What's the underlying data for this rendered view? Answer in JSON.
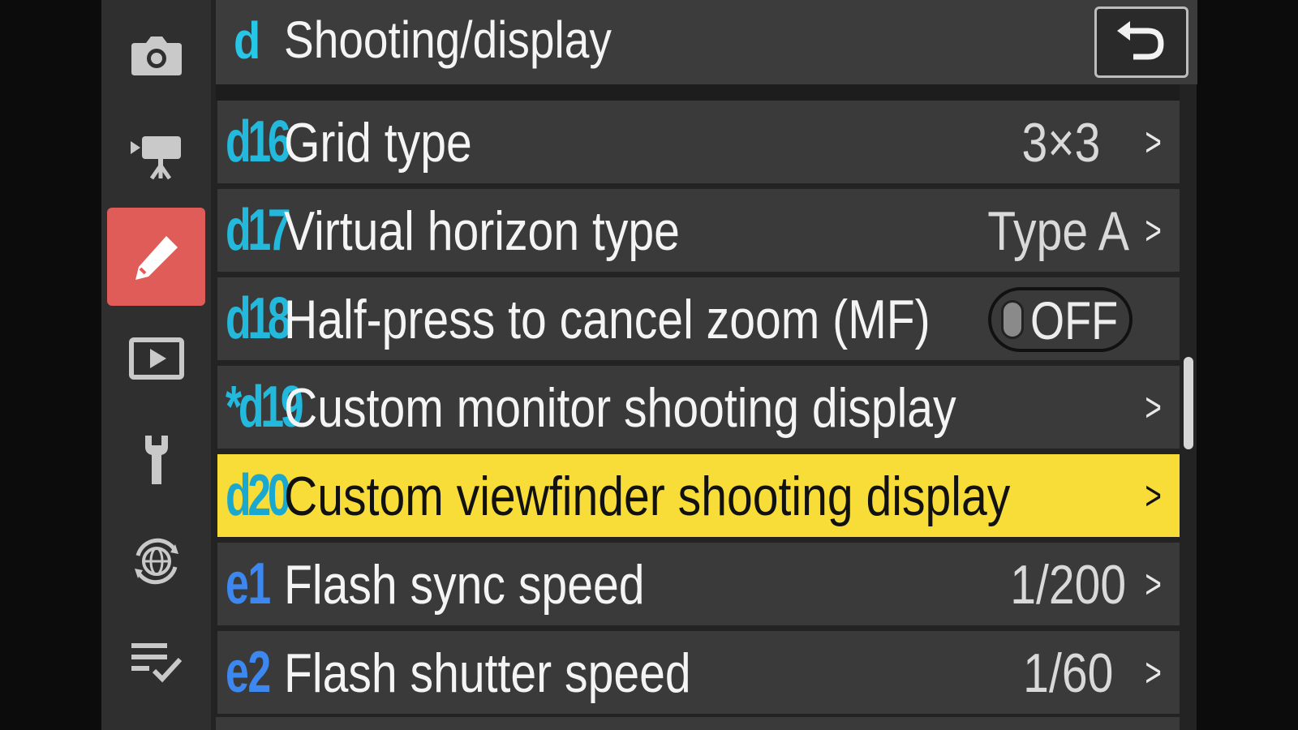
{
  "header": {
    "section_letter": "d",
    "title": "Shooting/display",
    "back_icon": "return-arrow-icon"
  },
  "sidebar": {
    "items": [
      {
        "id": "photo",
        "icon": "camera-icon"
      },
      {
        "id": "movie",
        "icon": "movie-camera-icon"
      },
      {
        "id": "custom",
        "icon": "pencil-icon",
        "active": true,
        "color": "#e05c58"
      },
      {
        "id": "playback",
        "icon": "playback-icon"
      },
      {
        "id": "setup",
        "icon": "wrench-icon"
      },
      {
        "id": "network",
        "icon": "network-globe-icon"
      },
      {
        "id": "mymenu",
        "icon": "my-menu-checklist-icon"
      }
    ]
  },
  "rows": [
    {
      "code": "d16",
      "label": "Grid type",
      "value": "3×3",
      "chevron": ">"
    },
    {
      "code": "d17",
      "label": "Virtual horizon type",
      "value": "Type A",
      "chevron": ">"
    },
    {
      "code": "d18",
      "label": "Half-press to cancel zoom (MF)",
      "toggle": "OFF"
    },
    {
      "code": "*d19",
      "label": "Custom monitor shooting display",
      "chevron": ">"
    },
    {
      "code": "d20",
      "label": "Custom viewfinder shooting display",
      "chevron": ">",
      "selected": true
    },
    {
      "code": "e1",
      "label": "Flash sync speed",
      "value": "1/200",
      "chevron": ">"
    },
    {
      "code": "e2",
      "label": "Flash shutter speed",
      "value": "1/60",
      "chevron": ">"
    }
  ],
  "colors": {
    "accent_cyan": "#27c6e6",
    "accent_blue": "#3c88f0",
    "selection_yellow": "#f8dd38",
    "active_tab": "#e05c58"
  }
}
